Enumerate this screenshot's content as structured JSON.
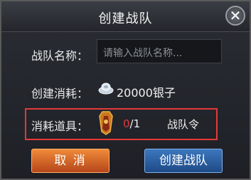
{
  "dialog": {
    "title": "创建战队",
    "close_glyph": "✕"
  },
  "form": {
    "team_name_label": "战队名称：",
    "team_name_placeholder": "请输入战队名称...",
    "cost_label": "创建消耗：",
    "cost_value": "20000银子",
    "cost_icon": "silver-ingot-icon",
    "item_label": "消耗道具：",
    "item_icon": "team-token-icon",
    "item_current": "0",
    "item_total": "/1",
    "item_name": "战队令"
  },
  "buttons": {
    "cancel": "取 消",
    "create": "创建战队"
  },
  "colors": {
    "highlight_border": "#e23a3a",
    "cancel_button": "#d46a2a",
    "create_button": "#2f62a3",
    "insufficient_count": "#e03a3a"
  }
}
